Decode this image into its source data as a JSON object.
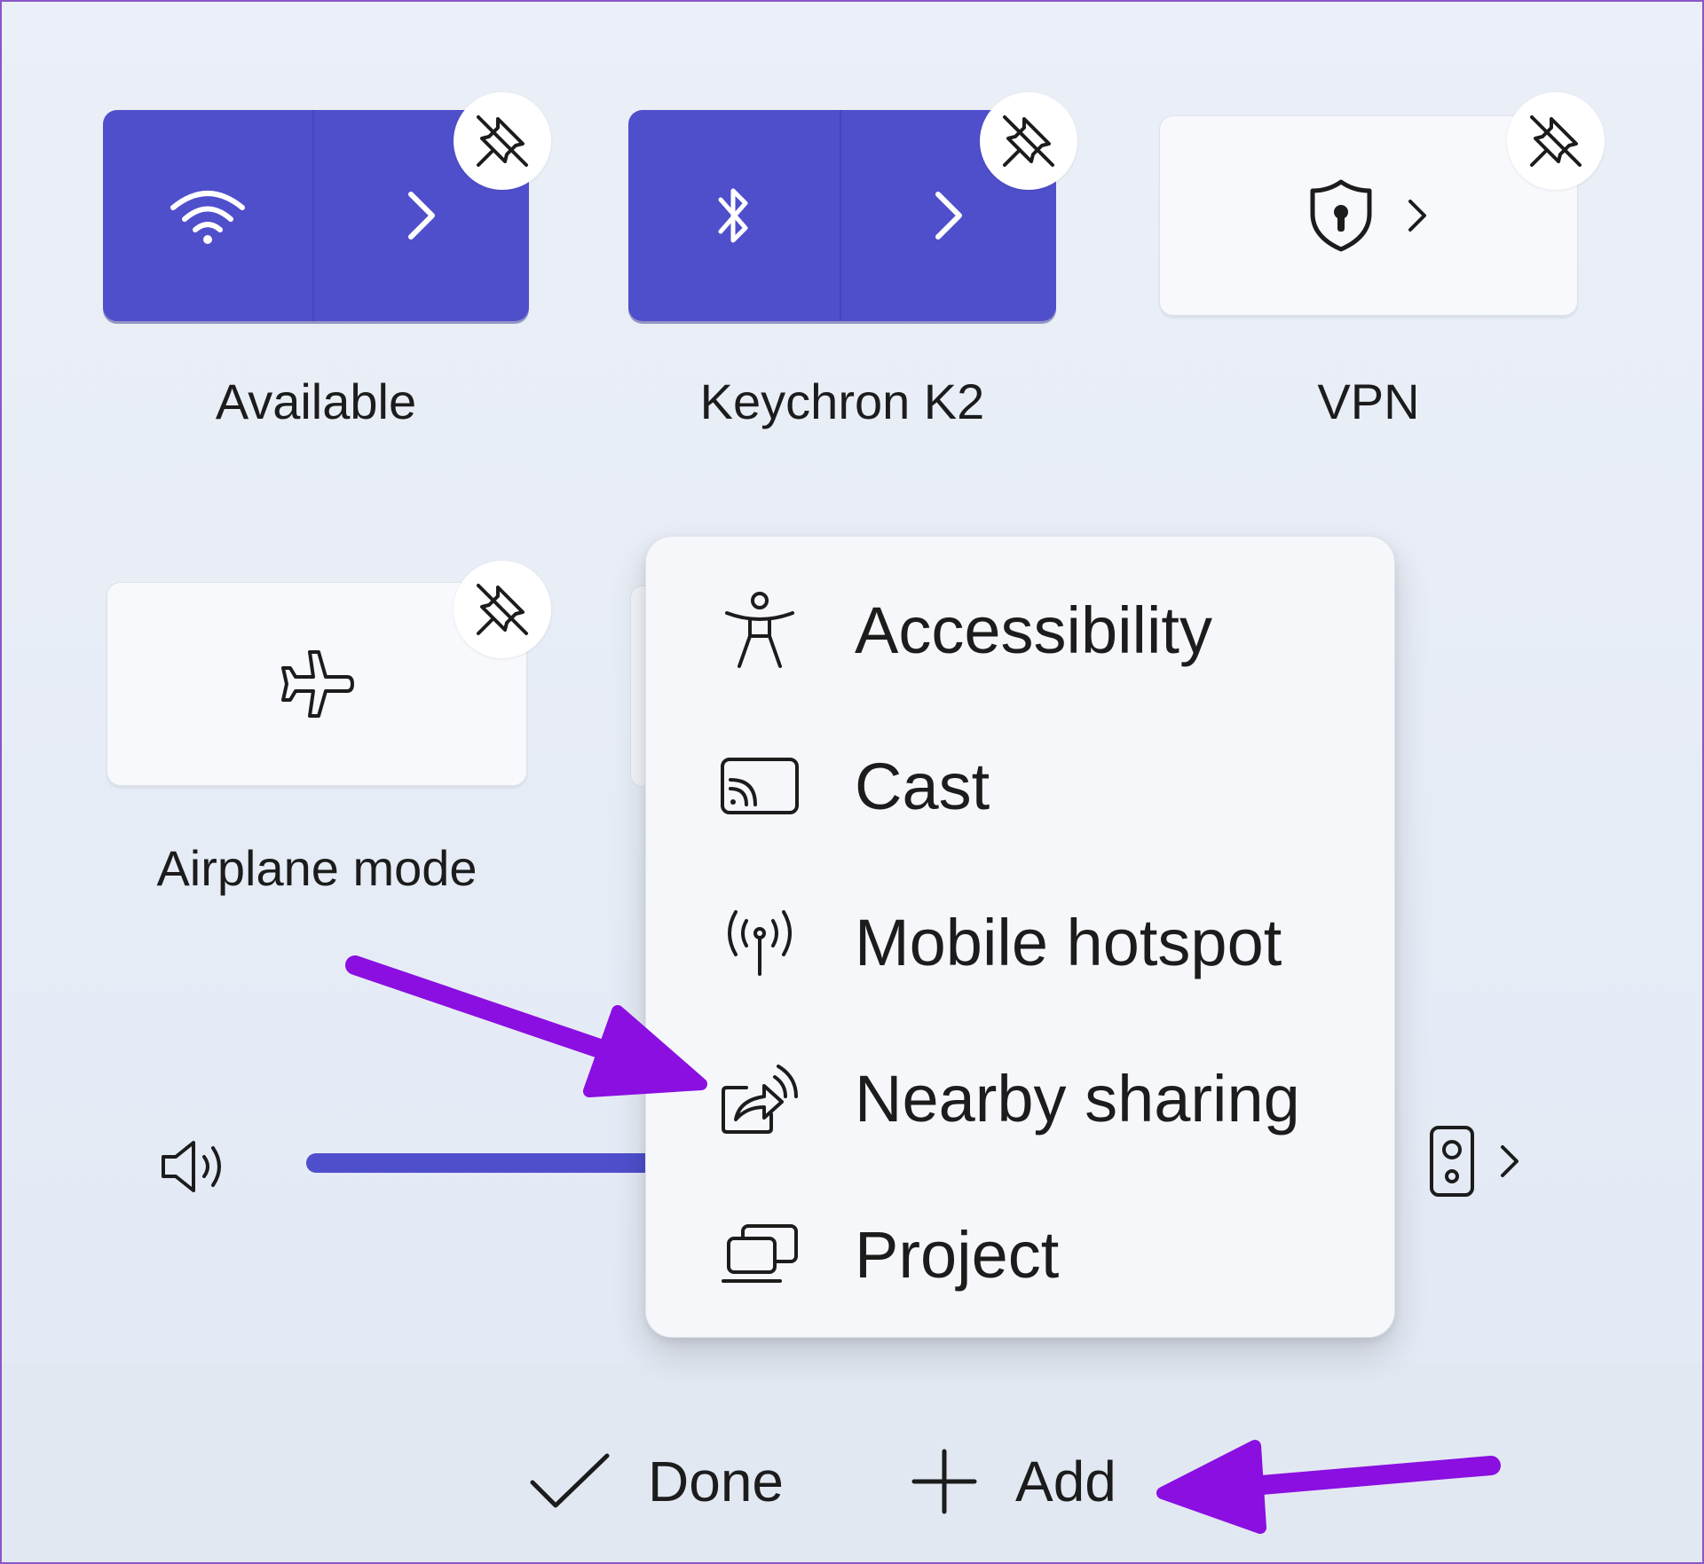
{
  "tiles": [
    {
      "id": "wifi",
      "label": "Available",
      "state": "on",
      "icon": "wifi-icon",
      "has_expand": true
    },
    {
      "id": "bluetooth",
      "label": "Keychron K2",
      "state": "on",
      "icon": "bluetooth-icon",
      "has_expand": true
    },
    {
      "id": "vpn",
      "label": "VPN",
      "state": "off",
      "icon": "shield-lock-icon",
      "has_expand": true
    },
    {
      "id": "airplane",
      "label": "Airplane mode",
      "state": "off",
      "icon": "airplane-icon",
      "has_expand": false
    }
  ],
  "volume": {
    "icon": "speaker-volume-icon",
    "output_icon": "speaker-device-icon"
  },
  "add_menu": {
    "items": [
      {
        "label": "Accessibility",
        "icon": "accessibility-icon"
      },
      {
        "label": "Cast",
        "icon": "cast-icon"
      },
      {
        "label": "Mobile hotspot",
        "icon": "mobile-hotspot-icon"
      },
      {
        "label": "Nearby sharing",
        "icon": "nearby-sharing-icon"
      },
      {
        "label": "Project",
        "icon": "project-icon"
      }
    ]
  },
  "footer": {
    "done_label": "Done",
    "add_label": "Add"
  },
  "colors": {
    "accent": "#4f4fcc",
    "annotation_arrow": "#8a0fe0",
    "menu_bg": "#f6f7fb"
  }
}
